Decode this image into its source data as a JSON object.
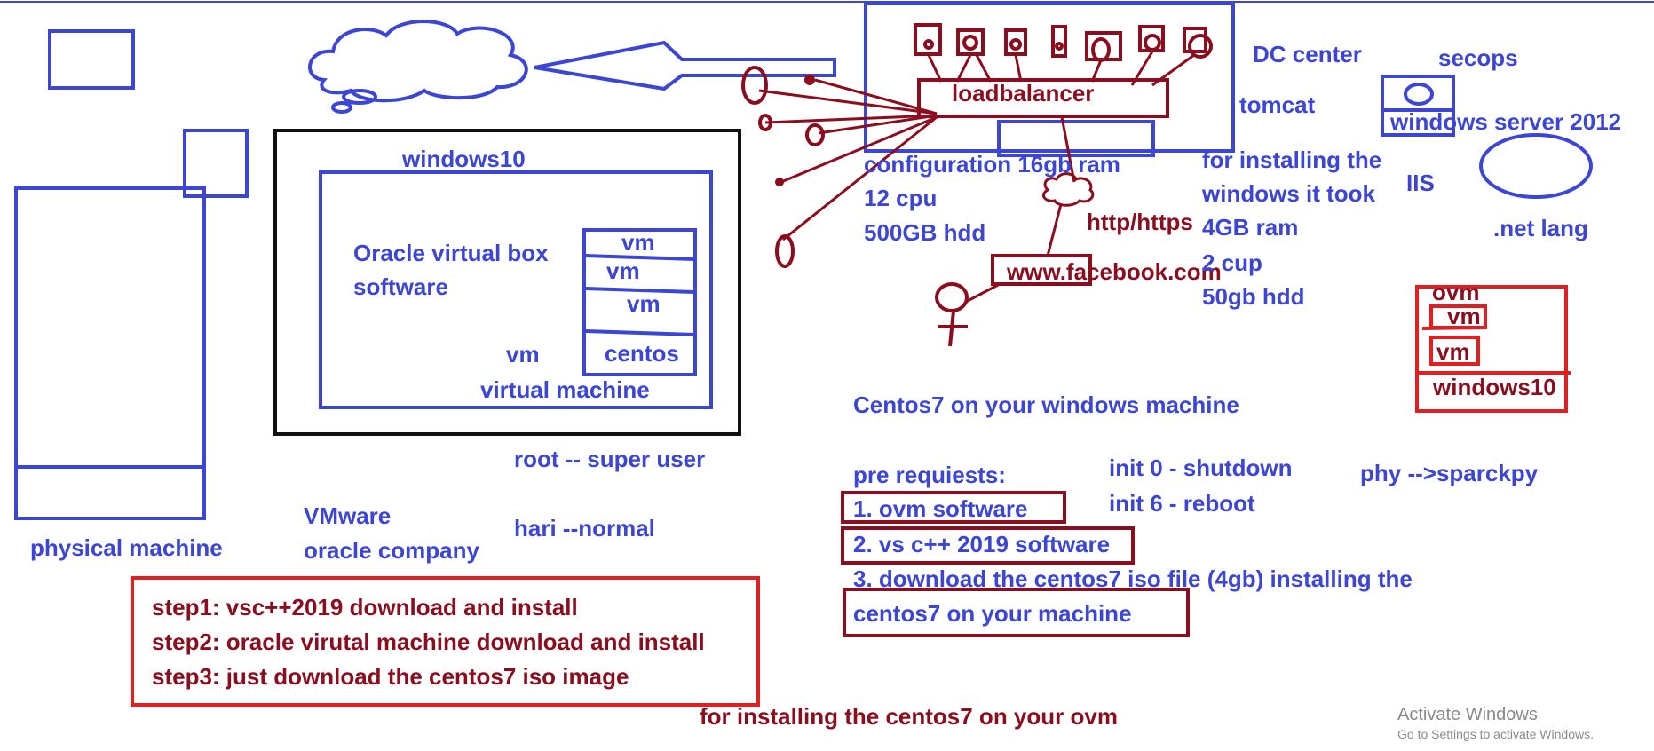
{
  "colors": {
    "pen_blue": "#3b45d6",
    "pen_maroon": "#8c0d1e",
    "pen_red": "#e02020",
    "pen_black": "#111111",
    "watermark_gray": "#8a8a8a"
  },
  "left": {
    "physical_machine": "physical machine",
    "vmware": "VMware",
    "oracle_company": "oracle company"
  },
  "vbox": {
    "windows10": "windows10",
    "oracle_line1": "Oracle virtual box",
    "oracle_line2": "software",
    "vm_stack": [
      "vm",
      "vm",
      "vm",
      "centos"
    ],
    "vm_label": "vm",
    "virtual_machine": "virtual machine"
  },
  "users": {
    "root": "root  -- super user",
    "hari": "hari --normal"
  },
  "steps": [
    "step1: vsc++2019 download and install",
    "step2: oracle virutal machine download and install",
    "step3: just download the centos7 iso image"
  ],
  "footer": "for installing the centos7 on your ovm",
  "dc": {
    "loadbalancer": "loadbalancer",
    "dc_center": "DC center",
    "tomcat": "tomcat",
    "config": [
      "configuration 16gb ram",
      "12 cpu",
      "500GB hdd"
    ],
    "http": "http/https",
    "facebook": "www.facebook.com"
  },
  "windows_install": [
    "for installing the",
    "windows it took",
    "4GB ram",
    "2 cup",
    "50gb hdd"
  ],
  "secops": {
    "secops": "secops",
    "windows_server": "windows server 2012",
    "iis": "IIS",
    "net": ".net lang"
  },
  "ovm_box": {
    "ovm": "ovm",
    "vm1": "vm",
    "vm2": "vm",
    "windows10": "windows10"
  },
  "centos": {
    "title": "Centos7 on your windows machine",
    "prereq": "pre requiests:",
    "items": [
      "1. ovm software",
      "2. vs c++ 2019 software",
      "3. download the centos7 iso file (4gb) installing the",
      "centos7 on your machine"
    ],
    "init0": "init 0 - shutdown",
    "init6": "init 6 - reboot",
    "phy": "phy  -->sparckpy"
  },
  "watermark": {
    "line1": "Activate Windows",
    "line2": "Go to Settings to activate Windows."
  }
}
